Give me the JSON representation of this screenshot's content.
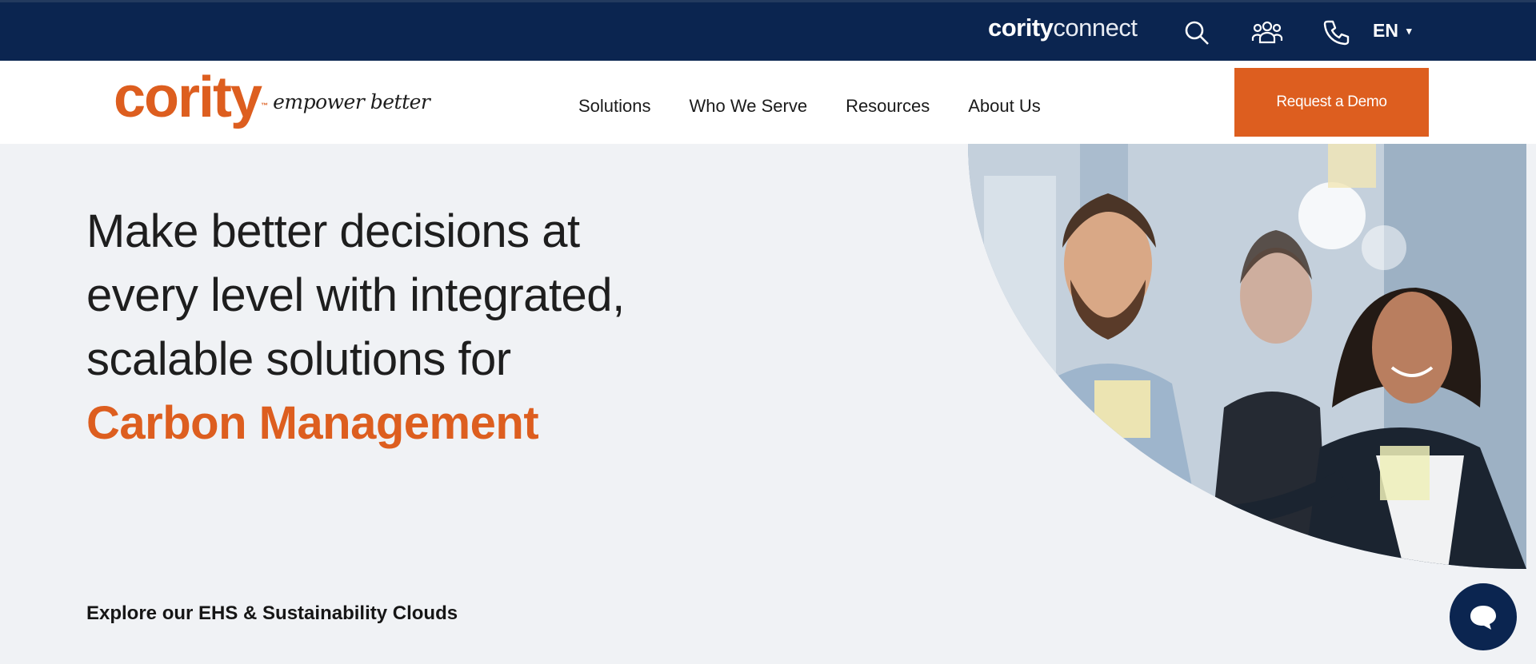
{
  "utility_bar": {
    "connect_logo_bold": "cority",
    "connect_logo_light": "connect",
    "search_icon": "search-icon",
    "community_icon": "people-icon",
    "phone_icon": "phone-icon",
    "language": "EN",
    "language_caret": "▾"
  },
  "nav": {
    "brand_word": "cority",
    "brand_tagline": "empower better",
    "links": [
      "Solutions",
      "Who We Serve",
      "Resources",
      "About Us"
    ],
    "cta_label": "Request a Demo"
  },
  "hero": {
    "heading_lines": [
      "Make better decisions at",
      "every level with integrated,",
      "scalable solutions for"
    ],
    "heading_accent": "Carbon Management",
    "explore_label": "Explore our EHS & Sustainability Clouds"
  },
  "chat": {
    "icon": "chat-bubble-icon"
  },
  "colors": {
    "navy": "#0b2550",
    "orange": "#dd5e1f",
    "hero_bg": "#f0f2f5"
  }
}
